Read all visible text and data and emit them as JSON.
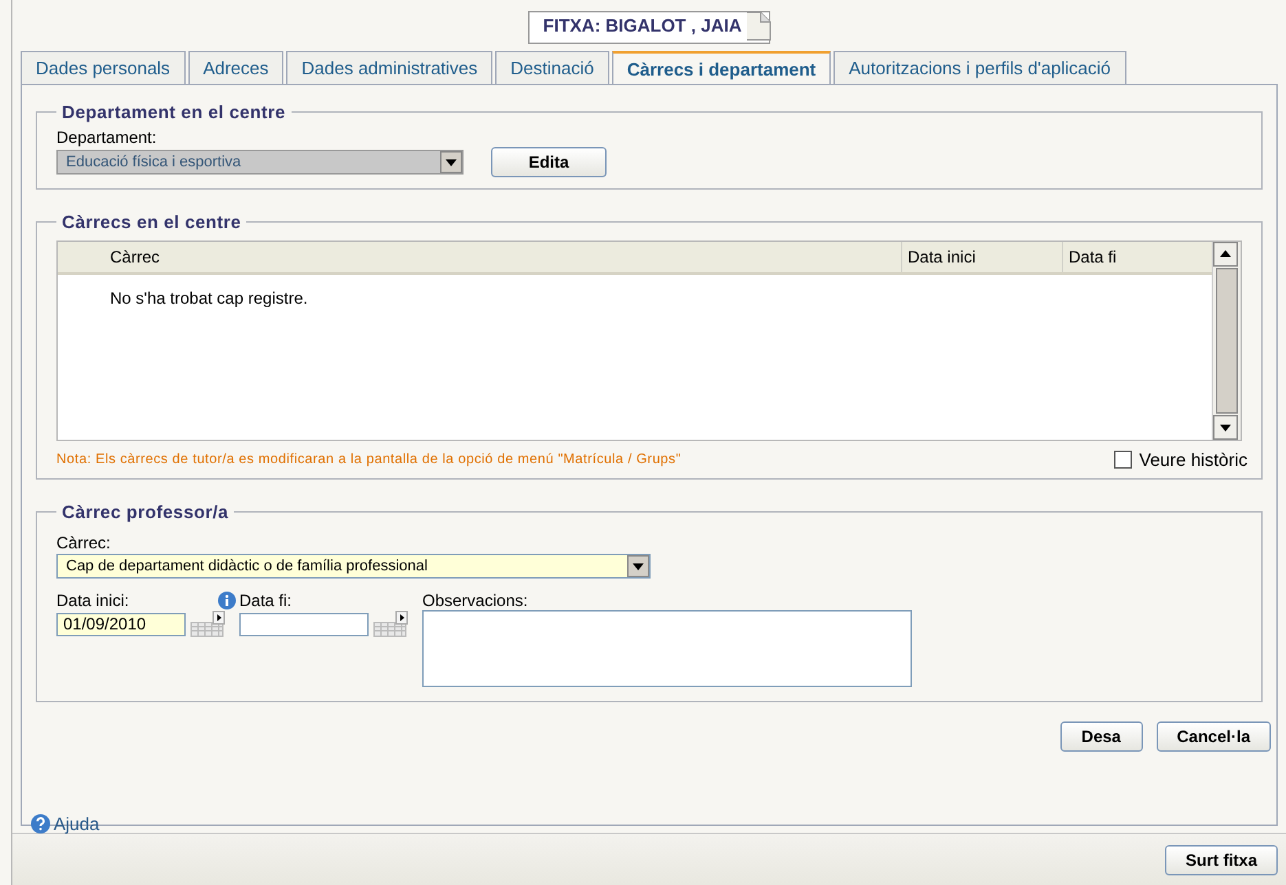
{
  "header": {
    "title": "FITXA: BIGALOT , JAIA"
  },
  "tabs": [
    {
      "label": "Dades personals",
      "selected": false
    },
    {
      "label": "Adreces",
      "selected": false
    },
    {
      "label": "Dades administratives",
      "selected": false
    },
    {
      "label": "Destinació",
      "selected": false
    },
    {
      "label": "Càrrecs i departament",
      "selected": true
    },
    {
      "label": "Autoritzacions i perfils d'aplicació",
      "selected": false
    }
  ],
  "department_section": {
    "legend": "Departament en el centre",
    "field_label": "Departament:",
    "select_value": "Educació física i esportiva",
    "disabled": true,
    "edit_button": "Edita"
  },
  "charges_section": {
    "legend": "Càrrecs en el centre",
    "columns": [
      "Càrrec",
      "Data inici",
      "Data fi"
    ],
    "empty_message": "No s'ha trobat cap registre.",
    "note": "Nota: Els càrrecs de tutor/a es modificaran a la pantalla de la opció de menú \"Matrícula / Grups\"",
    "history_checkbox": {
      "label": "Veure històric",
      "checked": false
    }
  },
  "teacher_charge": {
    "legend": "Càrrec professor/a",
    "charge_label": "Càrrec:",
    "charge_value": "Cap de departament didàctic o de família professional",
    "charge_highlighted": true,
    "start_label": "Data inici:",
    "start_value": "01/09/2010",
    "start_highlighted": true,
    "end_label": "Data fi:",
    "notes_label": "Observacions:"
  },
  "actions": [
    "Desa",
    "Cancel·la"
  ],
  "help_link": "Ajuda",
  "exit_button": "Surt fitxa"
}
